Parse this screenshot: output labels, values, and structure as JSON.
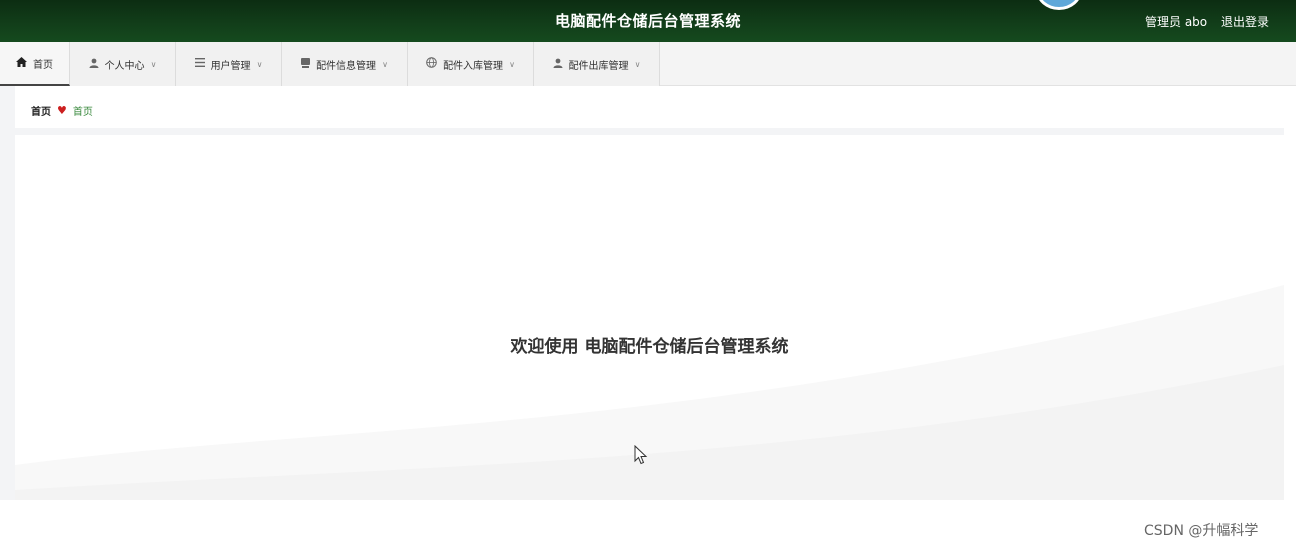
{
  "header": {
    "title": "电脑配件仓储后台管理系统",
    "user": "管理员 abo",
    "logout": "退出登录",
    "bg_color": "#123f1a"
  },
  "nav": {
    "items": [
      {
        "label": "首页",
        "icon": "home-icon"
      },
      {
        "label": "个人中心",
        "icon": "user-icon"
      },
      {
        "label": "用户管理",
        "icon": "list-icon"
      },
      {
        "label": "配件信息管理",
        "icon": "database-icon"
      },
      {
        "label": "配件入库管理",
        "icon": "globe-icon"
      },
      {
        "label": "配件出库管理",
        "icon": "person-icon"
      }
    ]
  },
  "breadcrumb": {
    "home": "首页",
    "current": "首页",
    "separator_icon": "heart-icon",
    "separator_color": "#cc1f1f",
    "current_color": "#3a8a3e"
  },
  "main": {
    "welcome": "欢迎使用 电脑配件仓储后台管理系统"
  },
  "watermark": "CSDN @升幅科学"
}
